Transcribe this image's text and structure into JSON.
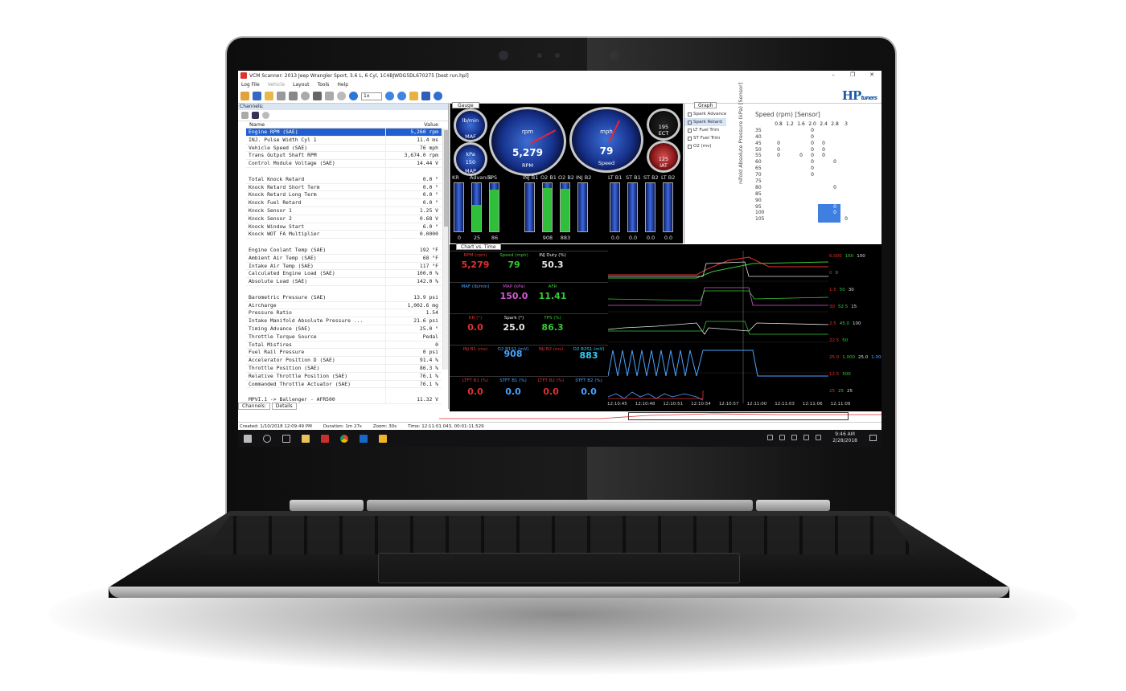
{
  "window": {
    "title": "VCM Scanner: 2013 Jeep Wrangler Sport, 3.6 L, 6 Cyl, 1C4BJWDG5DL670275 [best run.hpl]"
  },
  "menu": {
    "items": [
      "Log File",
      "Vehicle",
      "Layout",
      "Tools",
      "Help"
    ]
  },
  "toolbar": {
    "speed": "1x"
  },
  "brand": {
    "logo_main": "HP",
    "logo_sub": "tuners"
  },
  "channels": {
    "pane_title": "Channels:",
    "col_name": "Name",
    "col_value": "Value",
    "rows": [
      {
        "name": "Engine RPM (SAE)",
        "value": "5,260 rpm"
      },
      {
        "name": "INJ. Pulse Width Cyl 1",
        "value": "11.4 ms"
      },
      {
        "name": "Vehicle Speed (SAE)",
        "value": "76 mph"
      },
      {
        "name": "Trans Output Shaft RPM",
        "value": "3,674.0 rpm"
      },
      {
        "name": "Control Module Voltage (SAE)",
        "value": "14.44 V"
      },
      {
        "name": "",
        "value": ""
      },
      {
        "name": "Total Knock Retard",
        "value": "0.0 °"
      },
      {
        "name": "Knock Retard Short Term",
        "value": "0.0 °"
      },
      {
        "name": "Knock Retard Long Term",
        "value": "0.0 °"
      },
      {
        "name": "Knock Fuel Retard",
        "value": "0.0 °"
      },
      {
        "name": "Knock Sensor 1",
        "value": "1.25 V"
      },
      {
        "name": "Knock Sensor 2",
        "value": "0.68 V"
      },
      {
        "name": "Knock Window Start",
        "value": "6.0 °"
      },
      {
        "name": "Knock WOT FA Multiplier",
        "value": "0.0000"
      },
      {
        "name": "",
        "value": ""
      },
      {
        "name": "Engine Coolant Temp (SAE)",
        "value": "192 °F"
      },
      {
        "name": "Ambient Air Temp (SAE)",
        "value": "68 °F"
      },
      {
        "name": "Intake Air Temp (SAE)",
        "value": "117 °F"
      },
      {
        "name": "Calculated Engine Load (SAE)",
        "value": "100.0 %"
      },
      {
        "name": "Absolute Load (SAE)",
        "value": "142.0 %"
      },
      {
        "name": "",
        "value": ""
      },
      {
        "name": "Barometric Pressure (SAE)",
        "value": "13.9 psi"
      },
      {
        "name": "Aircharge",
        "value": "1,002.6 mg"
      },
      {
        "name": "Pressure Ratio",
        "value": "1.54"
      },
      {
        "name": "Intake Manifold Absolute Pressure ...",
        "value": "21.6 psi"
      },
      {
        "name": "Timing Advance (SAE)",
        "value": "25.0 °"
      },
      {
        "name": "Throttle Torque Source",
        "value": "Pedal"
      },
      {
        "name": "Total Misfires",
        "value": "0"
      },
      {
        "name": "Fuel Rail Pressure",
        "value": "0 psi"
      },
      {
        "name": "Accelerator Position D (SAE)",
        "value": "91.4 %"
      },
      {
        "name": "Throttle Position (SAE)",
        "value": "86.3 %"
      },
      {
        "name": "Relative Throttle Position (SAE)",
        "value": "76.1 %"
      },
      {
        "name": "Commanded Throttle Actuator (SAE)",
        "value": "76.1 %"
      },
      {
        "name": "",
        "value": ""
      },
      {
        "name": "MPVI.1 -> Ballenger - AFR500",
        "value": "11.32 V"
      }
    ],
    "tab_channels": "Channels:",
    "tab_details": "Details"
  },
  "gauge": {
    "tab": "Gauge",
    "rpm": {
      "label": "rpm",
      "value": "5,279",
      "caption": "RPM"
    },
    "speed": {
      "label": "mph",
      "value": "79",
      "caption": "Speed"
    },
    "maf": {
      "label": "lb/min",
      "caption": "MAF"
    },
    "map": {
      "label": "kPa",
      "value": "150",
      "caption": "MAP"
    },
    "ect": {
      "value": "195",
      "caption": "ECT"
    },
    "iat": {
      "value": "125",
      "caption": "IAT"
    },
    "bars": [
      {
        "label": "KR",
        "value": "0",
        "fill": 0
      },
      {
        "label": "Advance",
        "value": "25",
        "fill": 0.55
      },
      {
        "label": "TPS",
        "value": "86",
        "fill": 0.86
      },
      {
        "label": "INJ B1",
        "value": "",
        "fill": 0
      },
      {
        "label": "O2 B1",
        "value": "908",
        "fill": 0.9
      },
      {
        "label": "O2 B2",
        "value": "883",
        "fill": 0.88
      },
      {
        "label": "INJ B2",
        "value": "",
        "fill": 0
      },
      {
        "label": "LT B1",
        "value": "0.0",
        "fill": 0
      },
      {
        "label": "ST B1",
        "value": "0.0",
        "fill": 0
      },
      {
        "label": "ST B2",
        "value": "0.0",
        "fill": 0
      },
      {
        "label": "LT B2",
        "value": "0.0",
        "fill": 0
      }
    ]
  },
  "graph": {
    "tab": "Graph",
    "checks": [
      "Spark Advance",
      "Spark Retard",
      "LT Fuel Trim",
      "ST Fuel Trim",
      "O2 (mv)"
    ],
    "header": "Speed (rpm) [Sensor]",
    "y_label": "nifold Absolute Pressure (kPa) [Sensor]",
    "cols": [
      "0.8",
      "1.2",
      "1.6",
      "2.0",
      "2.4",
      "2.8",
      "3"
    ],
    "rows": [
      {
        "k": "35",
        "c": [
          "",
          "",
          "",
          "0",
          "",
          "",
          ""
        ]
      },
      {
        "k": "40",
        "c": [
          "",
          "",
          "",
          "0",
          "",
          "",
          ""
        ]
      },
      {
        "k": "45",
        "c": [
          "0",
          "",
          "",
          "0",
          "0",
          "",
          ""
        ]
      },
      {
        "k": "50",
        "c": [
          "0",
          "",
          "",
          "0",
          "0",
          "",
          ""
        ]
      },
      {
        "k": "55",
        "c": [
          "0",
          "",
          "0",
          "0",
          "0",
          "",
          ""
        ]
      },
      {
        "k": "60",
        "c": [
          "",
          "",
          "",
          "0",
          "",
          "0",
          ""
        ]
      },
      {
        "k": "65",
        "c": [
          "",
          "",
          "",
          "0",
          "",
          "",
          ""
        ]
      },
      {
        "k": "70",
        "c": [
          "",
          "",
          "",
          "0",
          "",
          "",
          ""
        ]
      },
      {
        "k": "75",
        "c": [
          "",
          "",
          "",
          "",
          "",
          "",
          ""
        ]
      },
      {
        "k": "80",
        "c": [
          "",
          "",
          "",
          "",
          "",
          "0",
          ""
        ]
      },
      {
        "k": "85",
        "c": [
          "",
          "",
          "",
          "",
          "",
          "",
          ""
        ]
      },
      {
        "k": "90",
        "c": [
          "",
          "",
          "",
          "",
          "",
          "",
          ""
        ]
      },
      {
        "k": "95",
        "c": [
          "",
          "",
          "",
          "",
          "",
          "0",
          ""
        ]
      },
      {
        "k": "100",
        "c": [
          "",
          "",
          "",
          "",
          "",
          "0",
          ""
        ]
      },
      {
        "k": "105",
        "c": [
          "",
          "",
          "",
          "",
          "",
          "",
          "0"
        ]
      }
    ]
  },
  "chart": {
    "tab": "Chart vs. Time",
    "readouts": [
      [
        {
          "c": "RPM (rpm)",
          "v": "5,279",
          "col": "#e53030"
        },
        {
          "c": "Speed (mph)",
          "v": "79",
          "col": "#36c936"
        },
        {
          "c": "INJ Duty (%)",
          "v": "50.3",
          "col": "#e8e8e8"
        }
      ],
      [
        {
          "c": "MAF (lb/min)",
          "v": "",
          "col": "#4aa3ff"
        },
        {
          "c": "MAP (kPa)",
          "v": "150.0",
          "col": "#d25ad2"
        },
        {
          "c": "AFR",
          "v": "11.41",
          "col": "#36c936"
        }
      ],
      [
        {
          "c": "KR (°)",
          "v": "0.0",
          "col": "#e53030"
        },
        {
          "c": "Spark (°)",
          "v": "25.0",
          "col": "#e8e8e8"
        },
        {
          "c": "TPS (%)",
          "v": "86.3",
          "col": "#36c936"
        }
      ],
      [
        {
          "c": "INJ B1 (ms)",
          "v": "",
          "col": "#e53030"
        },
        {
          "c": "O2 B1S1 (mV)",
          "v": "908",
          "col": "#4aa3ff"
        },
        {
          "c": "INJ B2 (ms)",
          "v": "",
          "col": "#e53030"
        },
        {
          "c": "O2 B2S1 (mV)",
          "v": "883",
          "col": "#36c9f0"
        }
      ],
      [
        {
          "c": "LTFT B1 (%)",
          "v": "0.0",
          "col": "#e53030"
        },
        {
          "c": "STFT B1 (%)",
          "v": "0.0",
          "col": "#4aa3ff"
        },
        {
          "c": "LTFT B2 (%)",
          "v": "0.0",
          "col": "#e53030"
        },
        {
          "c": "STFT B2 (%)",
          "v": "0.0",
          "col": "#4aa3ff"
        }
      ]
    ],
    "axis_labels": [
      [
        "6,000",
        "160",
        "100"
      ],
      [
        "0",
        "0"
      ],
      [
        "1.5",
        "50",
        "30"
      ],
      [
        "30",
        "52.5",
        "15"
      ],
      [
        "2.5",
        "45.0",
        "100"
      ],
      [
        "22.5",
        "50"
      ],
      [
        "25.0",
        "1.000",
        "25.0",
        "1.000"
      ],
      [
        "12.5",
        "500"
      ],
      [
        "25",
        "25",
        "25"
      ]
    ],
    "times": [
      "12:10:45",
      "12:10:48",
      "12:10:51",
      "12:10:54",
      "12:10:57",
      "12:11:00",
      "12:11:03",
      "12:11:06",
      "12:11:09"
    ]
  },
  "status": {
    "created": "Created: 1/10/2018 12:09:49 PM",
    "duration": "Duration: 1m 27s",
    "zoom": "Zoom: 30s",
    "time": "Time: 12:11:01.043, 00:01:11.529"
  },
  "taskbar": {
    "time": "9:46 AM",
    "date": "2/28/2018"
  }
}
